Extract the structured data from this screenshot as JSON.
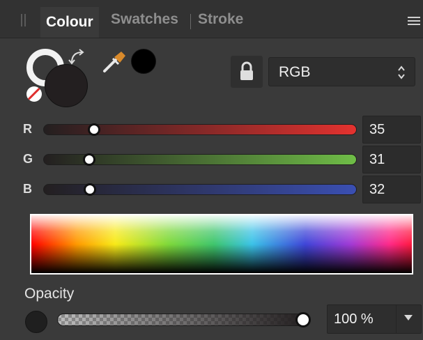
{
  "tabs": {
    "active": "Colour",
    "items": [
      "Colour",
      "Swatches",
      "Stroke"
    ]
  },
  "colour_model": {
    "selected": "RGB"
  },
  "channels": [
    {
      "label": "R",
      "value": "35",
      "fraction": 0.137,
      "color_end": "#e4322f"
    },
    {
      "label": "G",
      "value": "31",
      "fraction": 0.122,
      "color_end": "#6fbd47"
    },
    {
      "label": "B",
      "value": "32",
      "fraction": 0.125,
      "color_end": "#3a4fb2"
    }
  ],
  "current_colour": "#231f20",
  "opacity": {
    "label": "Opacity",
    "value": "100 %",
    "fraction": 1.0
  },
  "icons": {
    "grip": "panel-grip-icon",
    "menu": "panel-menu-icon",
    "swap": "swap-colours-icon",
    "none": "no-colour-icon",
    "picker": "colour-picker-icon",
    "lock": "lock-icon"
  }
}
